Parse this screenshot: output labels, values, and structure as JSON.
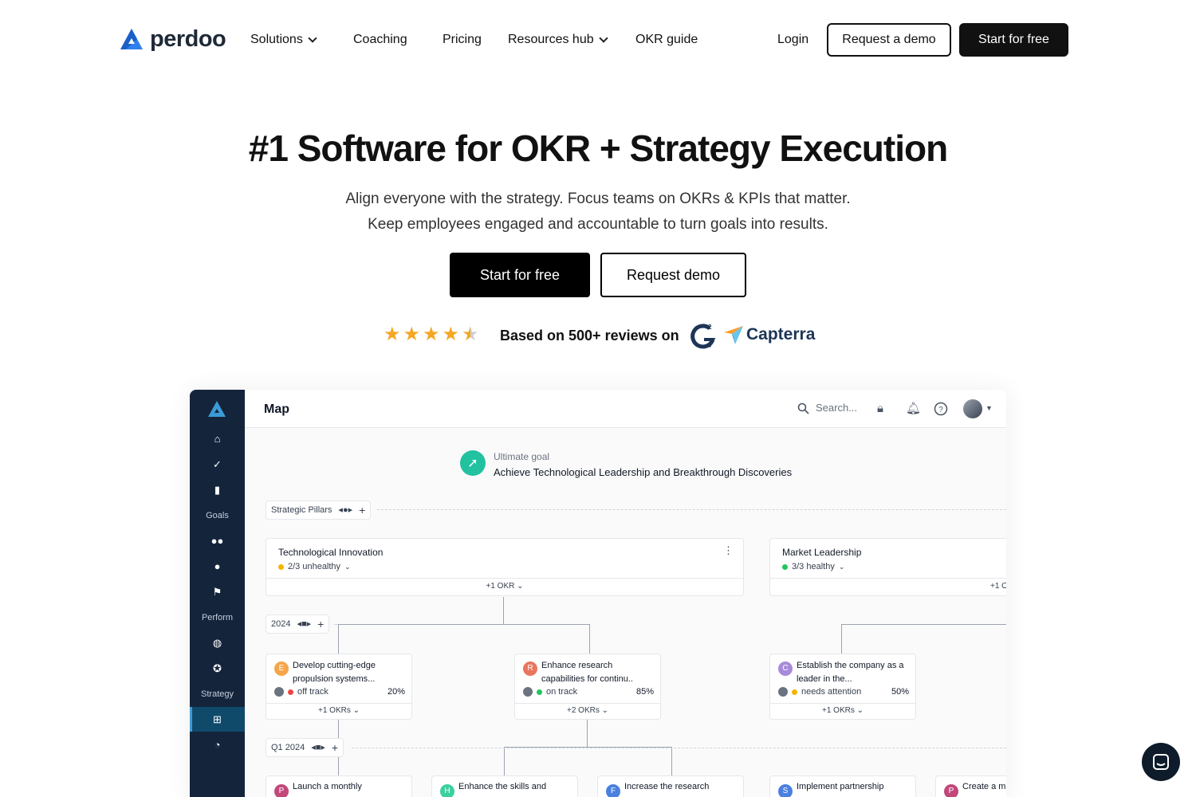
{
  "nav": {
    "logo_text": "perdoo",
    "items": [
      {
        "label": "Solutions"
      },
      {
        "label": "Coaching"
      },
      {
        "label": "Pricing"
      },
      {
        "label": "Resources hub"
      },
      {
        "label": "OKR guide"
      }
    ],
    "login": "Login",
    "request_demo": "Request a demo",
    "start_free": "Start for free"
  },
  "hero": {
    "title": "#1 Software for OKR + Strategy Execution",
    "subtitle_line1": "Align everyone with the strategy. Focus teams on OKRs & KPIs that matter.",
    "subtitle_line2": "Keep employees engaged and accountable to turn goals into results.",
    "cta_primary": "Start for free",
    "cta_secondary": "Request demo",
    "rating": 4.5,
    "reviews_text": "Based on 500+ reviews on",
    "review_sites": [
      "G2",
      "Capterra"
    ],
    "capterra_label": "Capterra",
    "colors": {
      "star": "#f5a623",
      "accent": "#000000"
    }
  },
  "app": {
    "sidebar": {
      "labels": {
        "goals": "Goals",
        "perform": "Perform",
        "strategy": "Strategy"
      }
    },
    "topbar": {
      "title": "Map",
      "search_placeholder": "Search..."
    },
    "ultimate_goal": {
      "label": "Ultimate goal",
      "text": "Achieve Technological Leadership and Breakthrough Discoveries"
    },
    "rows": {
      "pillars": "Strategic Pillars",
      "year": "2024",
      "quarter": "Q1 2024"
    },
    "pillars": [
      {
        "title": "Technological Innovation",
        "status": "2/3 unhealthy",
        "status_color": "#f5b400",
        "footer": "+1 OKR"
      },
      {
        "title": "Market Leadership",
        "status": "3/3 healthy",
        "status_color": "#22c55e",
        "footer": "+1 O"
      }
    ],
    "okrs": [
      {
        "badge": "E",
        "badge_color": "#f5a54a",
        "title": "Develop cutting-edge propulsion systems...",
        "status": "off track",
        "status_color": "#ef4444",
        "progress": "20%",
        "footer": "+1 OKRs"
      },
      {
        "badge": "R",
        "badge_color": "#e8765c",
        "title": "Enhance research capabilities for continu..",
        "status": "on track",
        "status_color": "#22c55e",
        "progress": "85%",
        "footer": "+2 OKRs"
      },
      {
        "badge": "C",
        "badge_color": "#a78bda",
        "title": "Establish the company as a leader in the...",
        "status": "needs attention",
        "status_color": "#f5b400",
        "progress": "50%",
        "footer": "+1 OKRs"
      }
    ],
    "key_results": [
      {
        "badge": "P",
        "badge_color": "#c2487a",
        "title": "Launch a monthly"
      },
      {
        "badge": "H",
        "badge_color": "#3ccfa0",
        "title": "Enhance the skills and"
      },
      {
        "badge": "F",
        "badge_color": "#4a80e0",
        "title": "Increase the research"
      },
      {
        "badge": "S",
        "badge_color": "#4a80e0",
        "title": "Implement partnership"
      },
      {
        "badge": "P",
        "badge_color": "#c2487a",
        "title": "Create a m"
      }
    ]
  }
}
